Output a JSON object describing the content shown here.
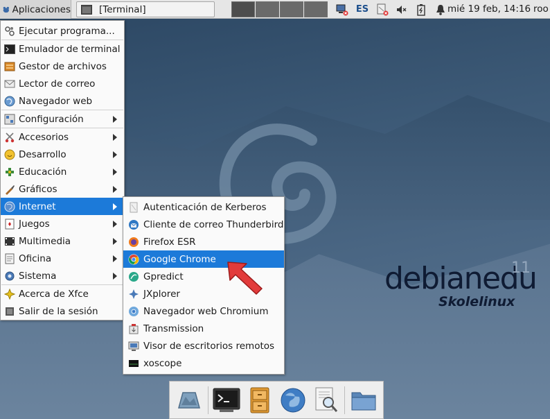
{
  "panel": {
    "apps_label": "Aplicaciones",
    "task_label": "[Terminal]",
    "keyboard_layout": "ES",
    "clock": "mié 19 feb, 14:16",
    "user": "roo"
  },
  "main_menu": {
    "items": [
      {
        "label": "Ejecutar programa...",
        "icon": "run-icon"
      },
      {
        "label": "Emulador de terminal",
        "icon": "terminal-icon"
      },
      {
        "label": "Gestor de archivos",
        "icon": "file-manager-icon"
      },
      {
        "label": "Lector de correo",
        "icon": "mail-icon"
      },
      {
        "label": "Navegador web",
        "icon": "web-browser-icon"
      },
      {
        "label": "Configuración",
        "icon": "settings-icon"
      },
      {
        "label": "Accesorios",
        "icon": "accessories-icon"
      },
      {
        "label": "Desarrollo",
        "icon": "development-icon"
      },
      {
        "label": "Educación",
        "icon": "education-icon"
      },
      {
        "label": "Gráficos",
        "icon": "graphics-icon"
      },
      {
        "label": "Internet",
        "icon": "internet-icon"
      },
      {
        "label": "Juegos",
        "icon": "games-icon"
      },
      {
        "label": "Multimedia",
        "icon": "multimedia-icon"
      },
      {
        "label": "Oficina",
        "icon": "office-icon"
      },
      {
        "label": "Sistema",
        "icon": "system-icon"
      },
      {
        "label": "Acerca de Xfce",
        "icon": "about-icon"
      },
      {
        "label": "Salir de la sesión",
        "icon": "logout-icon"
      }
    ]
  },
  "internet_menu": {
    "items": [
      {
        "label": "Autenticación de Kerberos",
        "icon": "kerberos-icon"
      },
      {
        "label": "Cliente de correo Thunderbird",
        "icon": "thunderbird-icon"
      },
      {
        "label": "Firefox ESR",
        "icon": "firefox-icon"
      },
      {
        "label": "Google Chrome",
        "icon": "chrome-icon"
      },
      {
        "label": "Gpredict",
        "icon": "gpredict-icon"
      },
      {
        "label": "JXplorer",
        "icon": "jxplorer-icon"
      },
      {
        "label": "Navegador web Chromium",
        "icon": "chromium-icon"
      },
      {
        "label": "Transmission",
        "icon": "transmission-icon"
      },
      {
        "label": "Visor de escritorios remotos",
        "icon": "remote-desktop-icon"
      },
      {
        "label": "xoscope",
        "icon": "xoscope-icon"
      }
    ]
  },
  "logo": {
    "name": "debianedu",
    "version": "11",
    "subtitle": "Skolelinux"
  },
  "colors": {
    "highlight": "#1c7ad9",
    "panel": "#e6e6e6",
    "pointer": "#e23b3b"
  }
}
